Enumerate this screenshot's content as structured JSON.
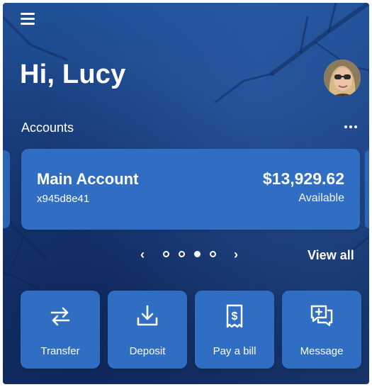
{
  "header": {
    "menu_icon": "hamburger-menu-icon",
    "greeting": "Hi, Lucy",
    "avatar_icon": "user-avatar"
  },
  "accounts": {
    "section_title": "Accounts",
    "more_icon": "more-horizontal-icon",
    "card": {
      "name": "Main Account",
      "number": "x945d8e41",
      "balance": "$13,929.62",
      "balance_label": "Available"
    },
    "pager": {
      "prev_icon": "chevron-left-icon",
      "next_icon": "chevron-right-icon",
      "total_pages": 4,
      "active_page": 3
    },
    "view_all_label": "View all"
  },
  "actions": [
    {
      "label": "Transfer",
      "icon": "transfer-arrows-icon"
    },
    {
      "label": "Deposit",
      "icon": "deposit-download-icon"
    },
    {
      "label": "Pay a bill",
      "icon": "bill-dollar-icon"
    },
    {
      "label": "Message",
      "icon": "message-plus-icon"
    }
  ],
  "colors": {
    "background": "#1a3f7d",
    "card": "#2f6ec2",
    "text": "#ffffff"
  }
}
